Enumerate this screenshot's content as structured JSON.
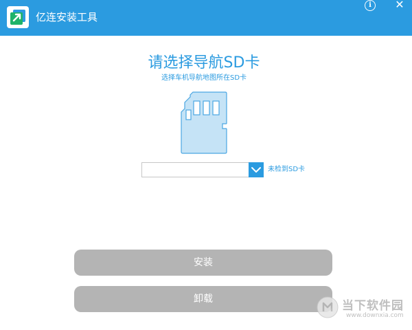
{
  "window": {
    "title": "亿连安装工具",
    "icons": {
      "app": "app-logo-icon",
      "info": "info-icon",
      "close": "close-icon"
    },
    "close_glyph": "✕",
    "info_glyph": "i"
  },
  "main": {
    "heading": "请选择导航SD卡",
    "subheading": "选择车机导航地图所在SD卡",
    "illustration_icon": "sd-card-icon",
    "sd_select": {
      "value": "",
      "dropdown_icon": "chevron-down-icon"
    },
    "status": "未检到SD卡"
  },
  "buttons": {
    "install": "安装",
    "uninstall": "卸载"
  },
  "watermark": {
    "name": "当下软件园",
    "url": "www.downxia.com"
  },
  "colors": {
    "accent": "#2b9be0",
    "button_disabled": "#b4b4b4",
    "card_fill": "#c5e3f6"
  }
}
